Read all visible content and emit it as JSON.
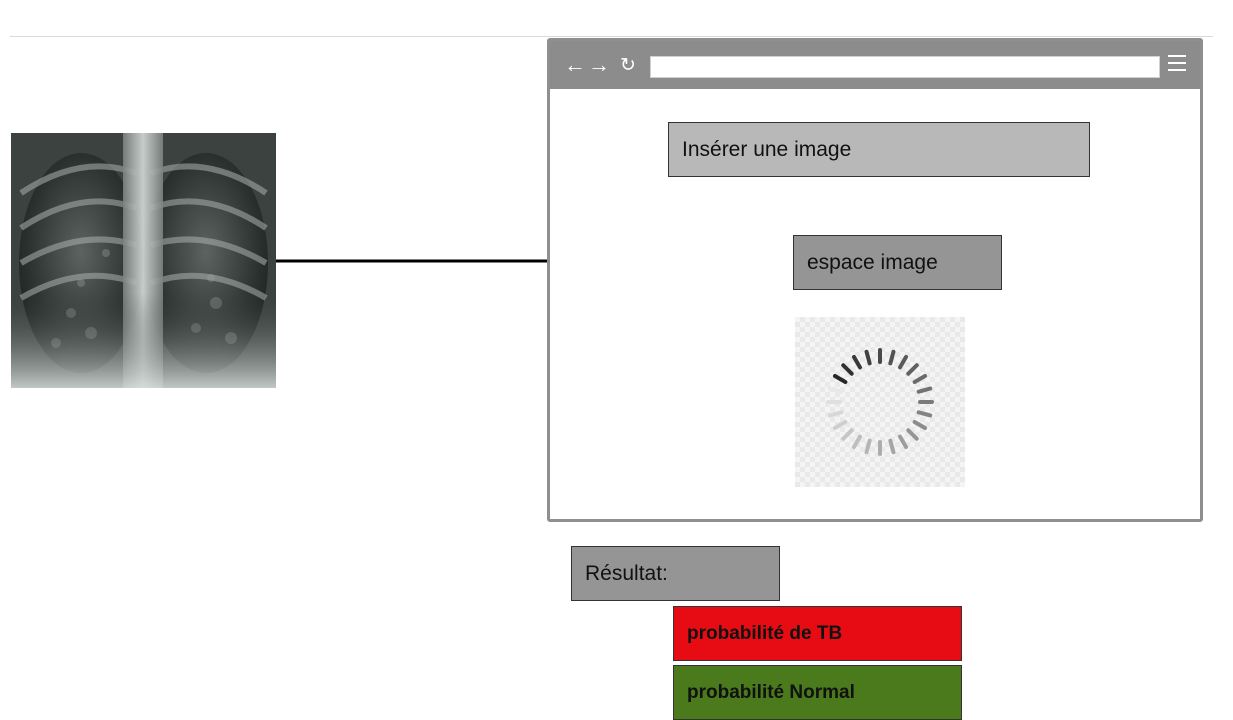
{
  "browser": {
    "nav": {
      "back": "←",
      "forward": "→",
      "reload": "↻"
    },
    "insert_button": "Insérer une image",
    "image_space": "espace image"
  },
  "result": {
    "label": "Résultat:",
    "tb_probability": "probabilité de TB",
    "normal_probability": "probabilité Normal"
  },
  "colors": {
    "tb": "#e70c13",
    "normal": "#4a7a1c",
    "box_gray": "#959595",
    "button_gray": "#b8b8b8",
    "browser_chrome": "#8c8c8c"
  },
  "icons": [
    "chest-xray-image",
    "loading-spinner-icon",
    "hamburger-menu-icon",
    "arrow-connector"
  ]
}
